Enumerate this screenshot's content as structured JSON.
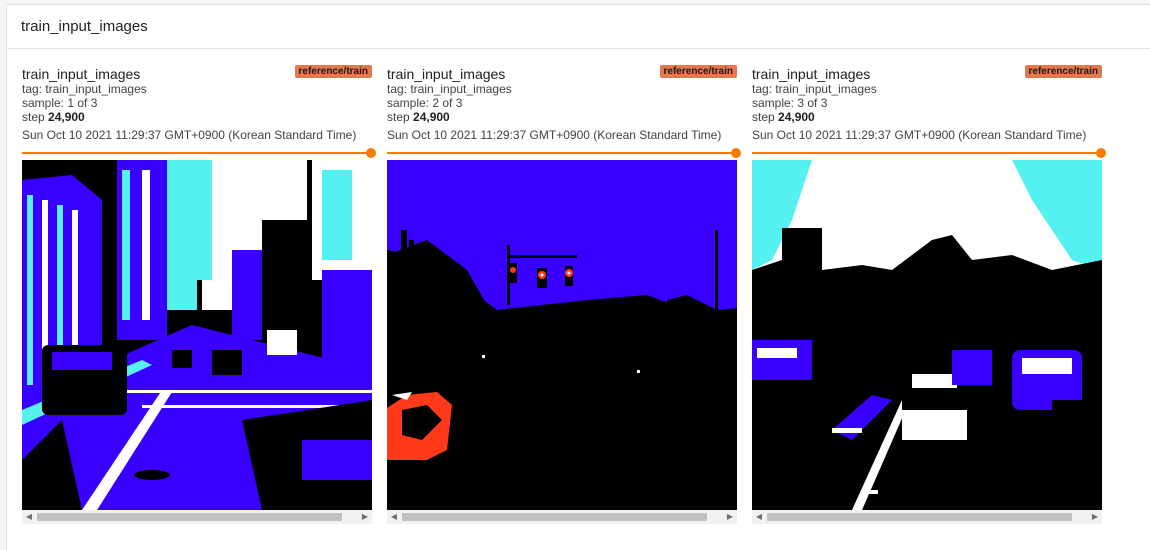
{
  "panel": {
    "title": "train_input_images"
  },
  "cards": [
    {
      "title": "train_input_images",
      "tag": "tag: train_input_images",
      "sample": "sample: 1 of 3",
      "step_label": "step",
      "step_value": "24,900",
      "time": "Sun Oct 10 2021 11:29:37 GMT+0900 (Korean Standard Time)",
      "run": "reference/train",
      "slider_fraction": 1.0
    },
    {
      "title": "train_input_images",
      "tag": "tag: train_input_images",
      "sample": "sample: 2 of 3",
      "step_label": "step",
      "step_value": "24,900",
      "time": "Sun Oct 10 2021 11:29:37 GMT+0900 (Korean Standard Time)",
      "run": "reference/train",
      "slider_fraction": 1.0
    },
    {
      "title": "train_input_images",
      "tag": "tag: train_input_images",
      "sample": "sample: 3 of 3",
      "step_label": "step",
      "step_value": "24,900",
      "time": "Sun Oct 10 2021 11:29:37 GMT+0900 (Korean Standard Time)",
      "run": "reference/train",
      "slider_fraction": 1.0
    }
  ],
  "colors": {
    "accent": "#f57c00",
    "run_badge": "#e6784d",
    "image_blue": "#3a00ff",
    "image_cyan": "#55f0f0",
    "image_red": "#ff3a1a"
  },
  "icons": {
    "scroll_left": "scroll-left-arrow-icon",
    "scroll_right": "scroll-right-arrow-icon"
  }
}
